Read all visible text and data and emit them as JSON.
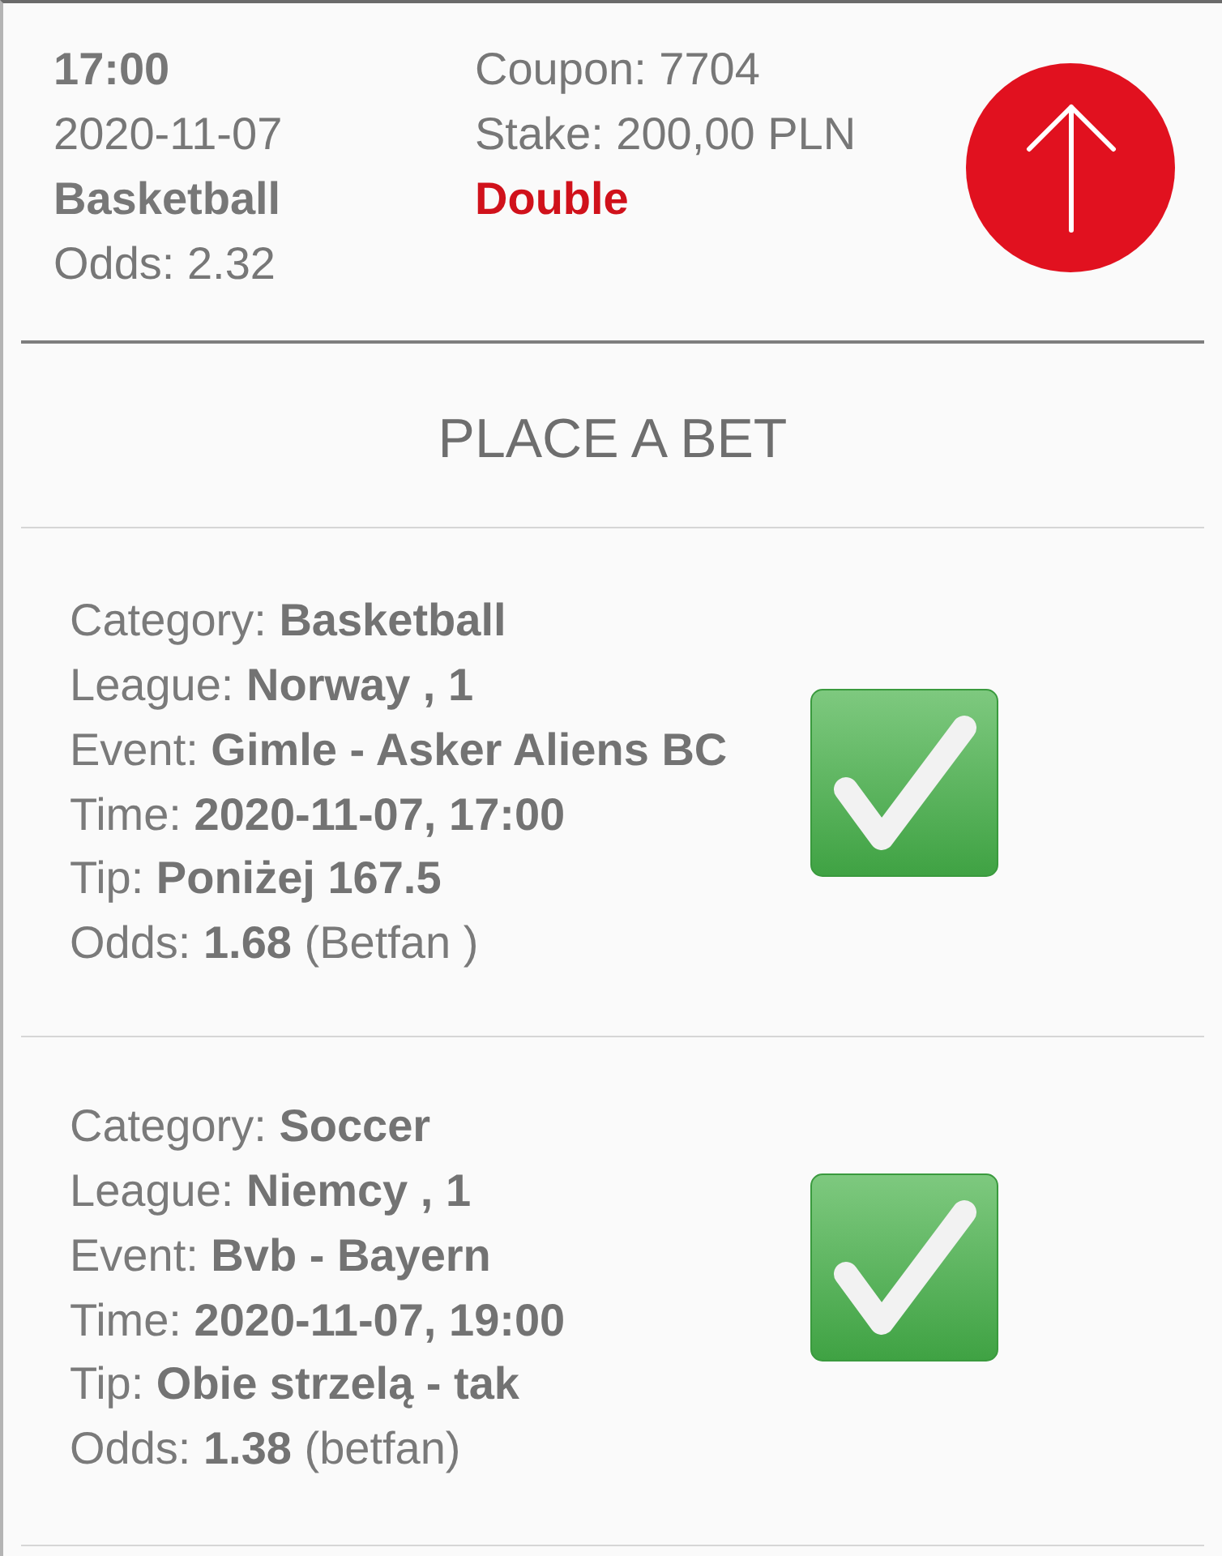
{
  "summary": {
    "time": "17:00",
    "date": "2020-11-07",
    "category": "Basketball",
    "odds": "Odds: 2.32",
    "coupon": "Coupon: 7704",
    "stake": "Stake: 200,00 PLN",
    "bet_type": "Double"
  },
  "place_bet_button": "PLACE A BET",
  "bets": [
    {
      "won": true,
      "fields": [
        {
          "label": "Category:",
          "value": "Basketball"
        },
        {
          "label": "League:",
          "value": "Norway , 1"
        },
        {
          "label": "Event:",
          "value": "Gimle - Asker Aliens BC"
        },
        {
          "label": "Time:",
          "value": "2020-11-07, 17:00"
        },
        {
          "label": "Tip:",
          "value": "Poniżej 167.5"
        },
        {
          "label": "Odds:",
          "value": "1.68",
          "note": "(Betfan )"
        }
      ]
    },
    {
      "won": true,
      "fields": [
        {
          "label": "Category:",
          "value": "Soccer"
        },
        {
          "label": "League:",
          "value": "Niemcy , 1"
        },
        {
          "label": "Event:",
          "value": "Bvb - Bayern"
        },
        {
          "label": "Time:",
          "value": "2020-11-07, 19:00"
        },
        {
          "label": "Tip:",
          "value": "Obie strzelą - tak"
        },
        {
          "label": "Odds:",
          "value": "1.38",
          "note": "(betfan)"
        }
      ]
    }
  ]
}
